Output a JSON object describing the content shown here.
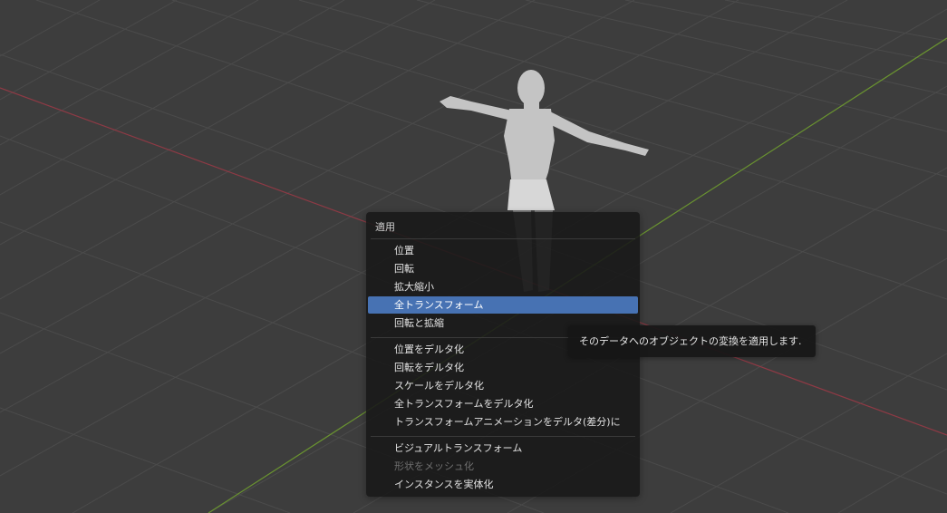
{
  "viewport": {
    "background_color": "#3d3d3d",
    "grid_color": "#4a4a4a",
    "x_axis_color": "#9a3a44",
    "y_axis_color": "#6d9a2e",
    "model_color": "#c9c9c9"
  },
  "menu": {
    "title": "適用",
    "accent_color": "#4772b3",
    "items": [
      {
        "label": "位置",
        "state": "normal"
      },
      {
        "label": "回転",
        "state": "normal"
      },
      {
        "label": "拡大縮小",
        "state": "normal"
      },
      {
        "label": "全トランスフォーム",
        "state": "highlighted"
      },
      {
        "label": "回転と拡縮",
        "state": "normal"
      },
      {
        "label": "位置をデルタ化",
        "state": "normal"
      },
      {
        "label": "回転をデルタ化",
        "state": "normal"
      },
      {
        "label": "スケールをデルタ化",
        "state": "normal"
      },
      {
        "label": "全トランスフォームをデルタ化",
        "state": "normal"
      },
      {
        "label": "トランスフォームアニメーションをデルタ(差分)に",
        "state": "normal"
      },
      {
        "label": "ビジュアルトランスフォーム",
        "state": "normal"
      },
      {
        "label": "形状をメッシュ化",
        "state": "disabled"
      },
      {
        "label": "インスタンスを実体化",
        "state": "normal"
      }
    ]
  },
  "tooltip": {
    "text": "そのデータへのオブジェクトの変換を適用します."
  }
}
